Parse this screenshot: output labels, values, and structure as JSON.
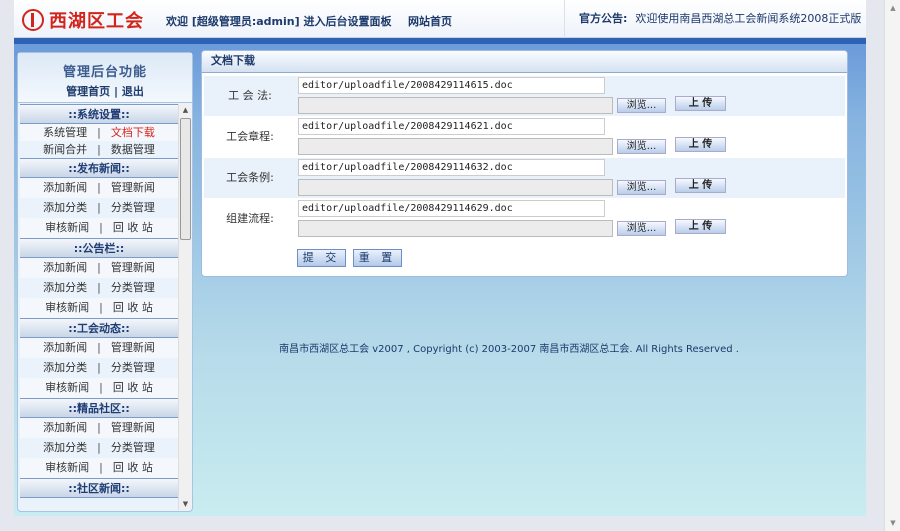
{
  "header": {
    "logo": "西湖区工会",
    "welcome": "欢迎 [超级管理员:admin] 进入后台设置面板",
    "home_link": "网站首页",
    "notice_label": "官方公告:",
    "notice_text": "欢迎使用南昌西湖总工会新闻系统2008正式版"
  },
  "sidebar": {
    "title": "管理后台功能",
    "home": "管理首页",
    "sep": "|",
    "logout": "退出",
    "sections": [
      {
        "title": "::系统设置::",
        "rows": [
          [
            "系统管理",
            "文档下载"
          ],
          [
            "新闻合并",
            "数据管理"
          ]
        ]
      },
      {
        "title": "::发布新闻::",
        "rows": [
          [
            "添加新闻",
            "管理新闻"
          ],
          [
            "添加分类",
            "分类管理"
          ],
          [
            "审核新闻",
            "回 收 站"
          ]
        ]
      },
      {
        "title": "::公告栏::",
        "rows": [
          [
            "添加新闻",
            "管理新闻"
          ],
          [
            "添加分类",
            "分类管理"
          ],
          [
            "审核新闻",
            "回 收 站"
          ]
        ]
      },
      {
        "title": "::工会动态::",
        "rows": [
          [
            "添加新闻",
            "管理新闻"
          ],
          [
            "添加分类",
            "分类管理"
          ],
          [
            "审核新闻",
            "回 收 站"
          ]
        ]
      },
      {
        "title": "::精品社区::",
        "rows": [
          [
            "添加新闻",
            "管理新闻"
          ],
          [
            "添加分类",
            "分类管理"
          ],
          [
            "审核新闻",
            "回 收 站"
          ]
        ]
      },
      {
        "title": "::社区新闻::",
        "rows": []
      }
    ],
    "active": "文档下载"
  },
  "panel": {
    "title": "文档下载",
    "browse_label": "浏览...",
    "upload_label": "上 传",
    "rows": [
      {
        "label": "工 会 法:",
        "value": "editor/uploadfile/2008429114615.doc"
      },
      {
        "label": "工会章程:",
        "value": "editor/uploadfile/2008429114621.doc"
      },
      {
        "label": "工会条例:",
        "value": "editor/uploadfile/2008429114632.doc"
      },
      {
        "label": "组建流程:",
        "value": "editor/uploadfile/2008429114629.doc"
      }
    ],
    "submit": "提 交",
    "reset": "重 置"
  },
  "footer": "南昌市西湖区总工会 v2007 , Copyright (c) 2003-2007 南昌市西湖区总工会. All Rights Reserved .",
  "colors": {
    "brand": "#d3241c",
    "nav": "#2f62b5"
  }
}
